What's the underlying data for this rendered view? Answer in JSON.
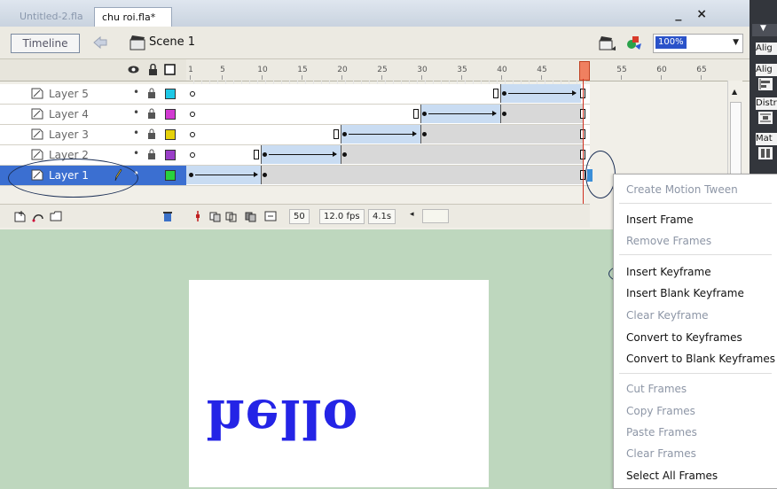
{
  "tabs": [
    {
      "label": "Untitled-2.fla",
      "active": false
    },
    {
      "label": "chu roi.fla*",
      "active": true
    }
  ],
  "window_controls": "_ ×",
  "scene_bar": {
    "timeline_button": "Timeline",
    "scene_label": "Scene 1",
    "zoom_value": "100%"
  },
  "ruler_ticks": [
    "1",
    "5",
    "10",
    "15",
    "20",
    "25",
    "30",
    "35",
    "40",
    "45",
    "55",
    "60",
    "65"
  ],
  "layers": [
    {
      "name": "Layer 5",
      "color": "#1ec8e6",
      "selected": false
    },
    {
      "name": "Layer 4",
      "color": "#d23ad2",
      "selected": false
    },
    {
      "name": "Layer 3",
      "color": "#e6d20a",
      "selected": false
    },
    {
      "name": "Layer 2",
      "color": "#9a3ec8",
      "selected": false
    },
    {
      "name": "Layer 1",
      "color": "#28d23c",
      "selected": true
    }
  ],
  "timeline_footer": {
    "current_frame": "50",
    "frame_rate": "12.0 fps",
    "elapsed_time": "4.1s"
  },
  "stage": {
    "text": "hello"
  },
  "context_menu": {
    "items": [
      {
        "label": "Create Motion Tween",
        "enabled": false
      },
      {
        "label": "Insert Frame",
        "enabled": true
      },
      {
        "label": "Remove Frames",
        "enabled": false
      },
      {
        "label": "Insert Keyframe",
        "enabled": true
      },
      {
        "label": "Insert Blank Keyframe",
        "enabled": true
      },
      {
        "label": "Clear Keyframe",
        "enabled": false
      },
      {
        "label": "Convert to Keyframes",
        "enabled": true
      },
      {
        "label": "Convert to Blank Keyframes",
        "enabled": true
      },
      {
        "label": "Cut Frames",
        "enabled": false
      },
      {
        "label": "Copy Frames",
        "enabled": false
      },
      {
        "label": "Paste Frames",
        "enabled": false
      },
      {
        "label": "Clear Frames",
        "enabled": false
      },
      {
        "label": "Select All Frames",
        "enabled": true
      }
    ]
  },
  "right_panel": {
    "labels": [
      "Alig",
      "Alig",
      "Distr",
      "Mat"
    ]
  }
}
